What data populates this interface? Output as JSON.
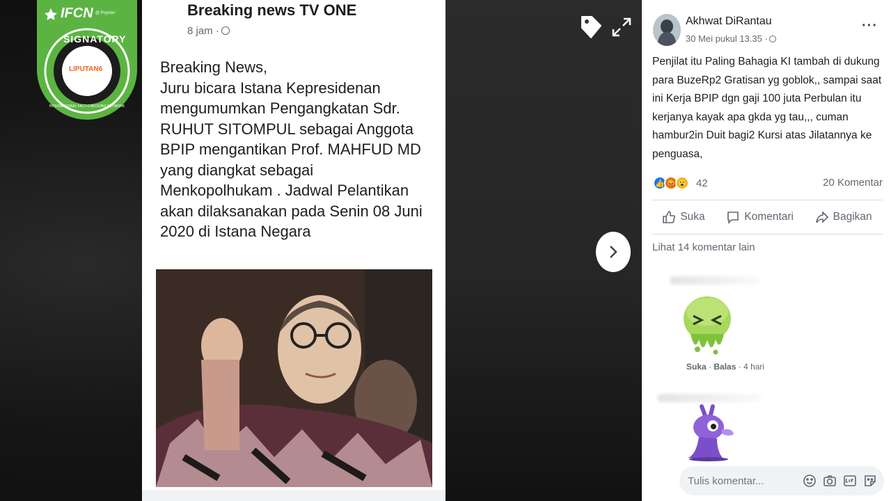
{
  "badge": {
    "ifcn": "IFCN",
    "ifcn_sub": "@ Poynter",
    "signatory": "SIGNATORY",
    "network": "INTERNATIONAL FACT-CHECKING NETWORK",
    "publisher": "LIPUTAN6"
  },
  "post": {
    "page_name": "Breaking news TV ONE",
    "time": "8 jam ·",
    "body_lines": [
      "Breaking News,",
      "Juru bicara Istana Kepresidenan",
      "mengumumkan Pengangkatan Sdr.",
      "RUHUT SITOMPUL sebagai Anggota",
      "BPIP mengantikan Prof. MAHFUD MD",
      "yang diangkat sebagai",
      "Menkopolhukam . Jadwal Pelantikan",
      "akan dilaksanakan pada Senin 08 Juni",
      "2020 di Istana Negara"
    ]
  },
  "panel": {
    "author": "Akhwat DiRantau",
    "timestamp": "30 Mei pukul 13.35 ·",
    "more": "···",
    "caption": "Penjilat itu Paling Bahagia KI tambah di dukung para BuzeRp2 Gratisan yg goblok,, sampai saat ini Kerja BPIP dgn gaji 100 juta Perbulan itu kerjanya kayak apa gkda yg tau,,, cuman hambur2in Duit bagi2 Kursi atas Jilatannya ke penguasa,",
    "reaction_count": "42",
    "comment_count": "20 Komentar",
    "actions": {
      "like": "Suka",
      "comment": "Komentari",
      "share": "Bagikan"
    },
    "more_comments": "Lihat 14 komentar lain",
    "comment1_meta": {
      "like": "Suka",
      "reply": "Balas",
      "age": "4 hari"
    },
    "input_placeholder": "Tulis komentar..."
  },
  "colors": {
    "fb_blue": "#1877f2",
    "badge_green": "#5bb442",
    "text_dark": "#1c1e21",
    "text_muted": "#606770"
  },
  "icons": [
    "tag-icon",
    "expand-icon",
    "chevron-right-icon",
    "globe-icon",
    "like-icon",
    "comment-icon",
    "share-icon",
    "emoji-icon",
    "camera-icon",
    "gif-icon",
    "sticker-icon"
  ]
}
